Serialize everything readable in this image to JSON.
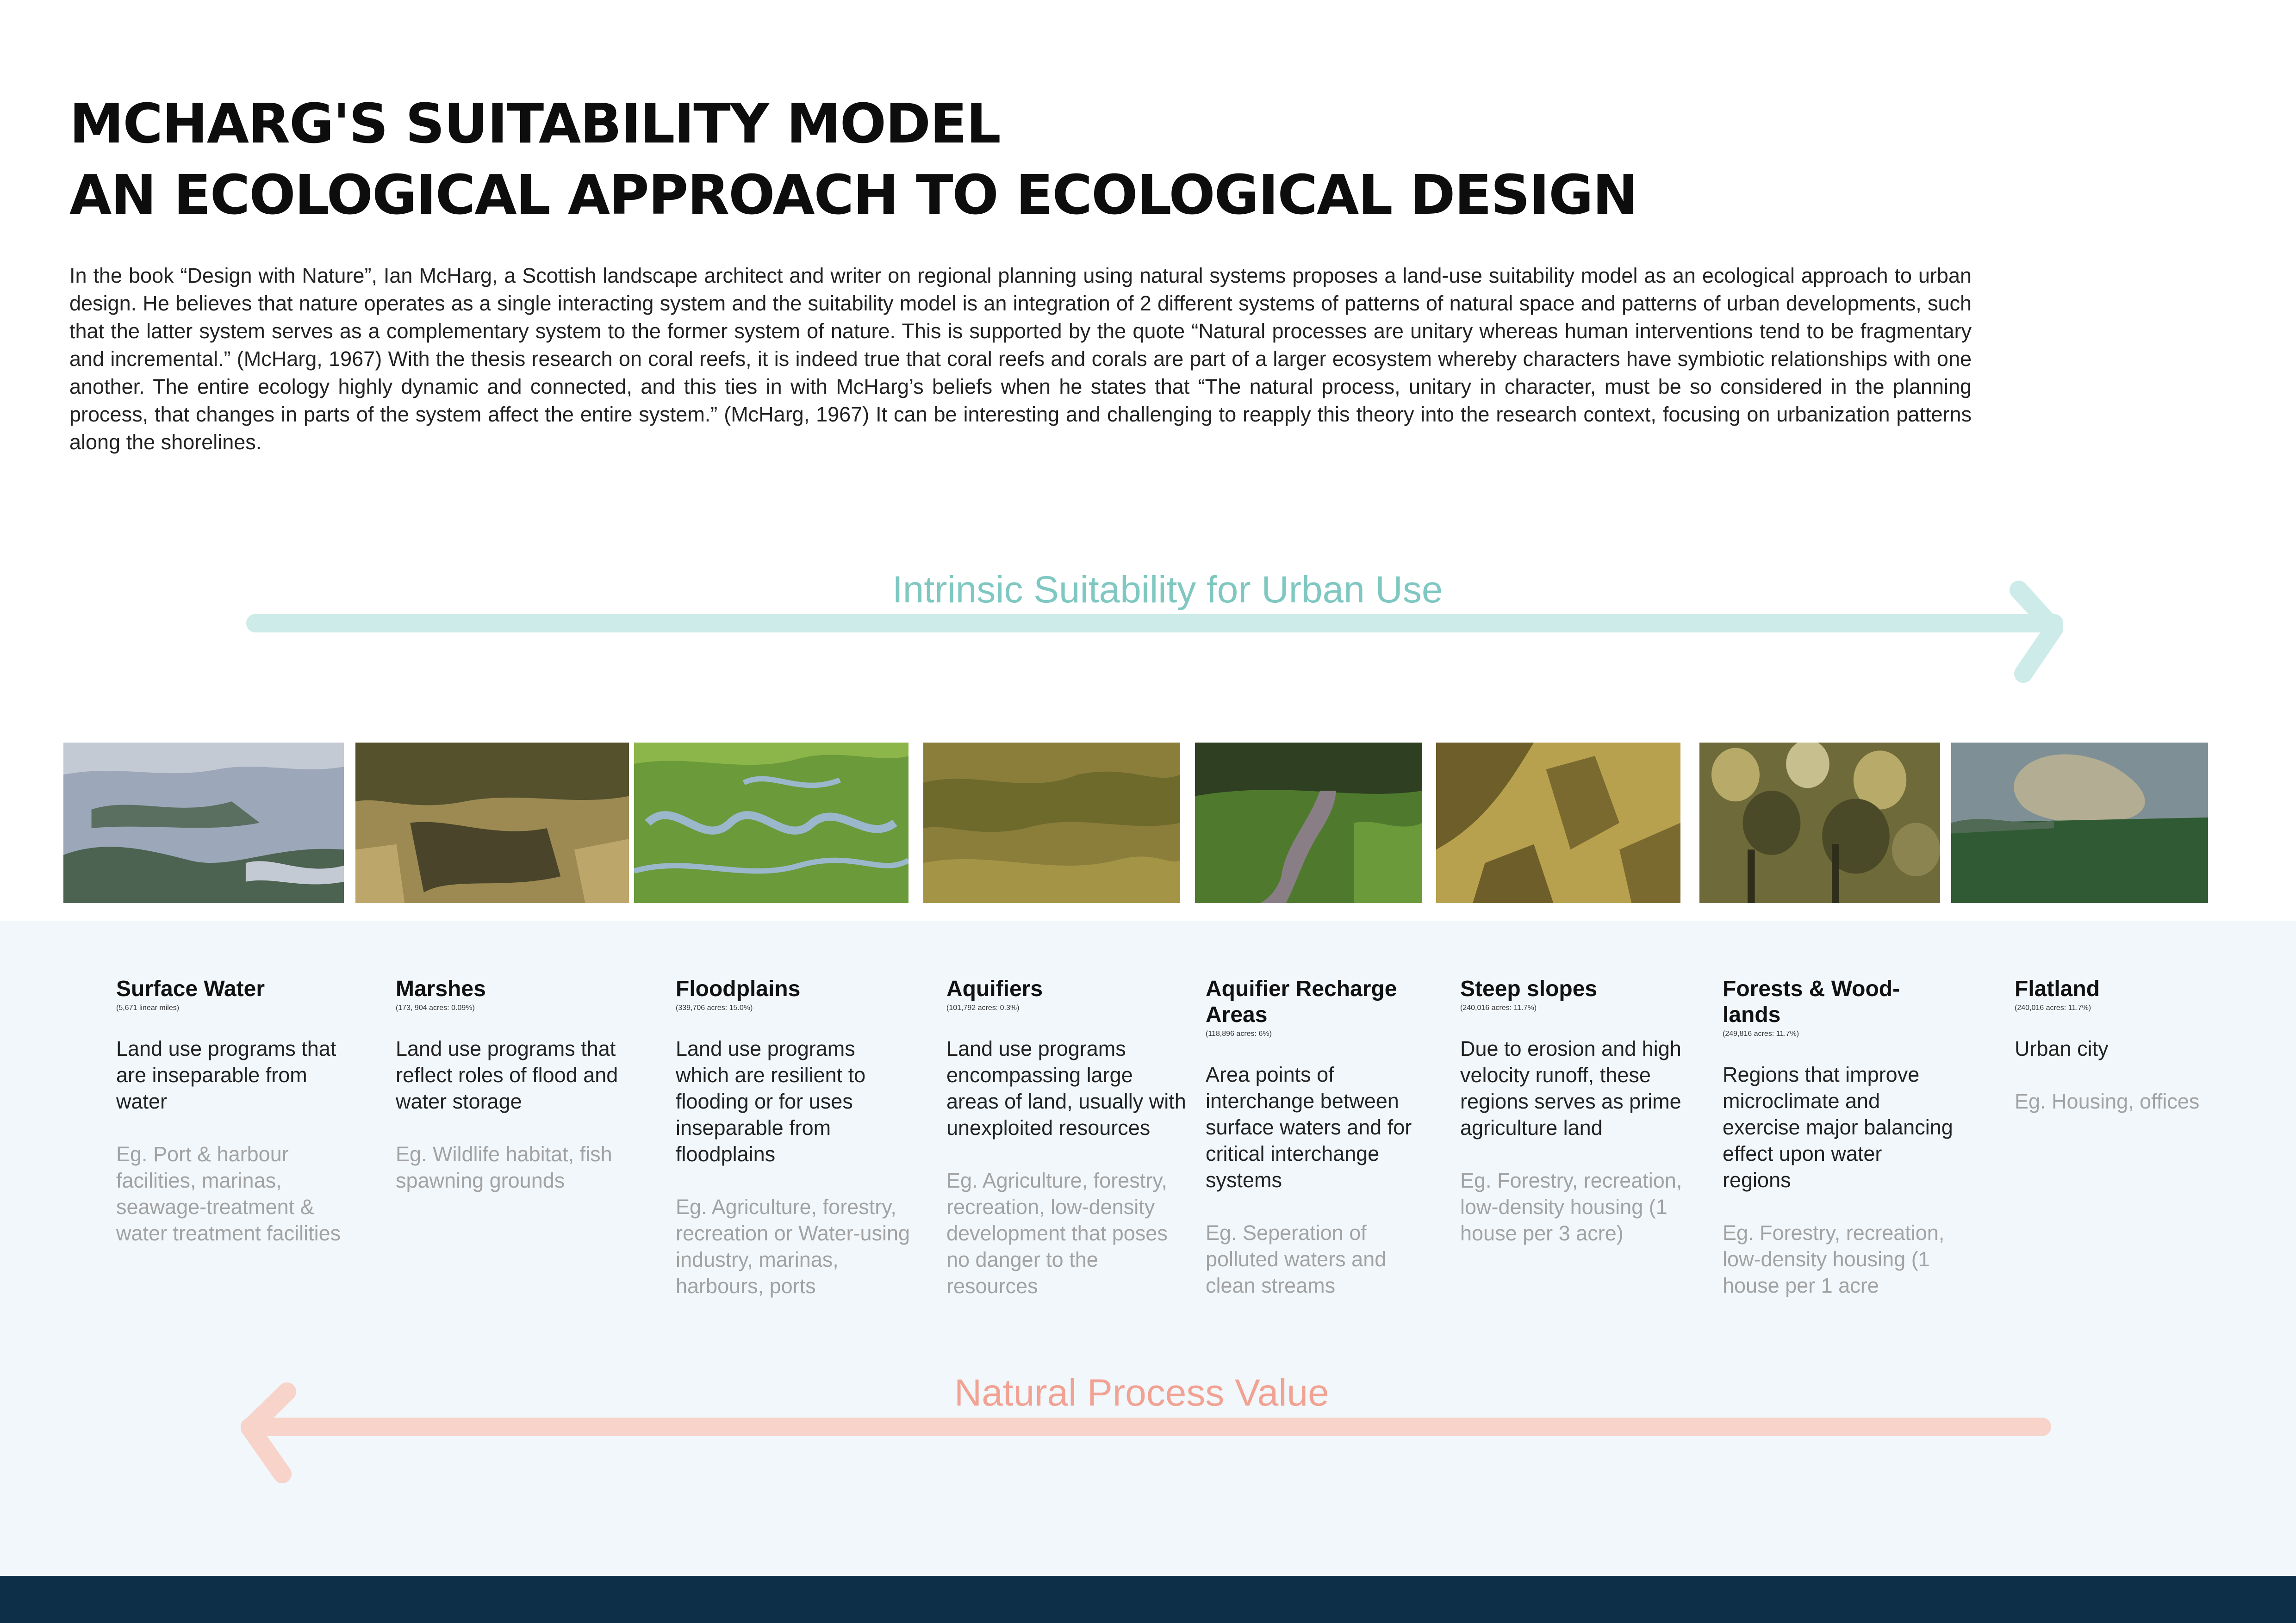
{
  "header": {
    "title_line1": "McHarg's Suitability Model",
    "title_line2": "An Ecological Approach to Ecological Design"
  },
  "intro": {
    "text": "In the book “Design with Nature”, Ian McHarg, a Scottish landscape architect and writer on regional planning using natural systems proposes a land-use suitability model as an ecological approach to urban design. He believes that nature operates as a single interacting system and the suitability model is an integration of 2 different systems of patterns of natural space and patterns of urban developments, such that the latter system serves as a complementary system to the former system of nature. This is supported by the quote “Natural processes are unitary whereas human interventions tend to be fragmentary and incremental.” (McHarg, 1967) With the thesis research on coral reefs, it is indeed true that coral reefs and corals are part of a larger ecosystem whereby characters have symbiotic relationships with one another. The entire ecology highly dynamic and connected, and this ties in with McHarg’s beliefs when he states that “The natural process, unitary in character, must be so considered in the planning process, that changes in parts of the system affect the entire system.” (McHarg, 1967) It can be interesting and challenging to reapply this theory into the research context, focusing on urbanization patterns along the shorelines."
  },
  "arrows": {
    "top_label": "Intrinsic Suitability for Urban Use",
    "bottom_label": "Natural Process Value",
    "top_color": "#cdebe8",
    "bottom_color": "#f7d3ca"
  },
  "categories": [
    {
      "title": "Surface Water",
      "subtitle": "(5,671 linear miles)",
      "description": "Land use programs that are inseparable from water",
      "example": "Eg. Port & harbour facilities, marinas, seawage-treatment & water treatment facilities"
    },
    {
      "title": "Marshes",
      "subtitle": "(173, 904 acres: 0.09%)",
      "description": "Land use programs that reflect roles of flood and water storage",
      "example": "Eg. Wildlife habitat, fish spawning grounds"
    },
    {
      "title": "Floodplains",
      "subtitle": "(339,706 acres: 15.0%)",
      "description": "Land use programs which are resilient to flooding or for uses inseparable from floodplains",
      "example": "Eg. Agriculture, forestry, recreation or Water-using industry, marinas, harbours, ports"
    },
    {
      "title": "Aquifiers",
      "subtitle": "(101,792 acres: 0.3%)",
      "description": "Land use programs encompassing large areas of land, usually with unexploited resources",
      "example": "Eg. Agriculture, forestry, recreation, low-density development that poses no danger to the resources"
    },
    {
      "title": "Aquifier Recharge Areas",
      "subtitle": "(118,896 acres: 6%)",
      "description": "Area points of interchange between surface waters and for critical interchange systems",
      "example": "Eg. Seperation of polluted waters and clean streams"
    },
    {
      "title": "Steep slopes",
      "subtitle": "(240,016 acres: 11.7%)",
      "description": "Due to erosion and high velocity runoff, these regions serves as prime agriculture land",
      "example": "Eg. Forestry, recreation, low-density housing (1 house per 3 acre)"
    },
    {
      "title": "Forests & Wood-lands",
      "subtitle": "(249,816 acres: 11.7%)",
      "description": "Regions that improve microclimate and exercise major balancing effect upon water regions",
      "example": "Eg. Forestry, recreation, low-density housing (1 house per 1 acre"
    },
    {
      "title": "Flatland",
      "subtitle": "(240,016 acres: 11.7%)",
      "description": "Urban city",
      "example": "Eg. Housing, offices"
    }
  ]
}
